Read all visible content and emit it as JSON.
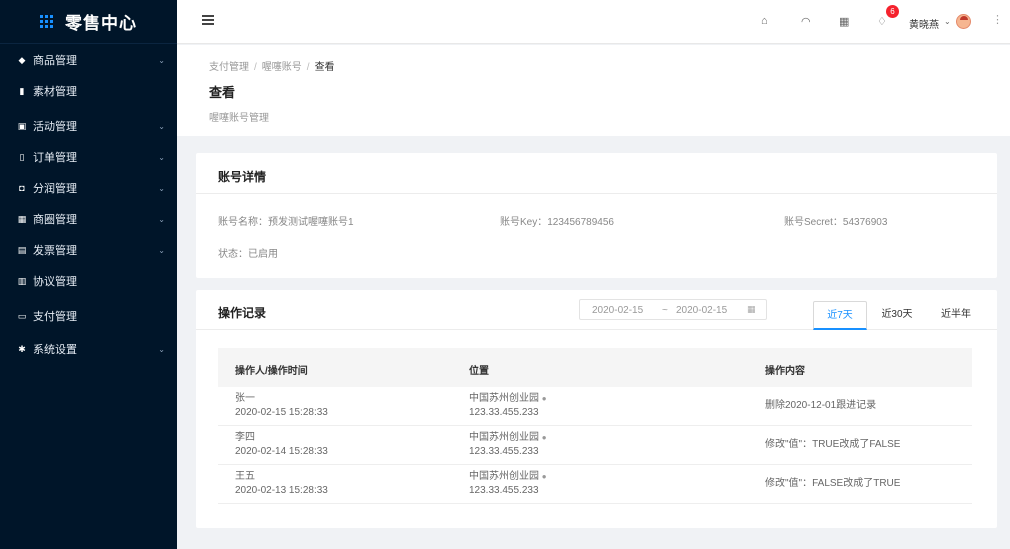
{
  "app": {
    "logo_text": "零售中心"
  },
  "sidebar": {
    "items": [
      {
        "icon": "tag-icon",
        "glyph": "◆",
        "label": "商品管理",
        "has_children": true
      },
      {
        "icon": "file-icon",
        "glyph": "▮",
        "label": "素材管理",
        "has_children": false
      },
      {
        "icon": "calendar-icon",
        "glyph": "▣",
        "label": "活动管理",
        "has_children": true
      },
      {
        "icon": "bookmark-icon",
        "glyph": "▯",
        "label": "订单管理",
        "has_children": true
      },
      {
        "icon": "inbox-icon",
        "glyph": "◘",
        "label": "分润管理",
        "has_children": true
      },
      {
        "icon": "apps-icon",
        "glyph": "▦",
        "label": "商圈管理",
        "has_children": true
      },
      {
        "icon": "invoice-icon",
        "glyph": "▤",
        "label": "发票管理",
        "has_children": true
      },
      {
        "icon": "clipboard-icon",
        "glyph": "▥",
        "label": "协议管理",
        "has_children": false
      },
      {
        "icon": "credit-card-icon",
        "glyph": "▭",
        "label": "支付管理",
        "has_children": false
      },
      {
        "icon": "gear-icon",
        "glyph": "✱",
        "label": "系统设置",
        "has_children": true
      }
    ]
  },
  "header": {
    "notification_count": "6",
    "username": "黄晓燕"
  },
  "page": {
    "breadcrumb": [
      "支付管理",
      "喔噻账号",
      "查看"
    ],
    "title": "查看",
    "subtitle": "喔噻账号管理"
  },
  "account_details": {
    "title": "账号详情",
    "fields": {
      "name_label": "账号名称：",
      "name_value": "预发测试喔噻账号1",
      "key_label": "账号Key：",
      "key_value": "123456789456",
      "secret_label": "账号Secret：",
      "secret_value": "54376903",
      "status_label": "状态：",
      "status_value": "已启用"
    }
  },
  "operations": {
    "title": "操作记录",
    "date_start": "2020-02-15",
    "date_sep": "~",
    "date_end": "2020-02-15",
    "tabs": [
      "近7天",
      "近30天",
      "近半年"
    ],
    "active_tab": 0,
    "columns": [
      "操作人/操作时间",
      "位置",
      "操作内容"
    ],
    "rows": [
      {
        "operator": "张一",
        "time": "2020-02-15 15:28:33",
        "location": "中国苏州创业园",
        "ip": "123.33.455.233",
        "content": "删除2020-12-01跟进记录"
      },
      {
        "operator": "李四",
        "time": "2020-02-14 15:28:33",
        "location": "中国苏州创业园",
        "ip": "123.33.455.233",
        "content": "修改\"值\"：TRUE改成了FALSE"
      },
      {
        "operator": "王五",
        "time": "2020-02-13 15:28:33",
        "location": "中国苏州创业园",
        "ip": "123.33.455.233",
        "content": "修改\"值\"：FALSE改成了TRUE"
      }
    ]
  }
}
